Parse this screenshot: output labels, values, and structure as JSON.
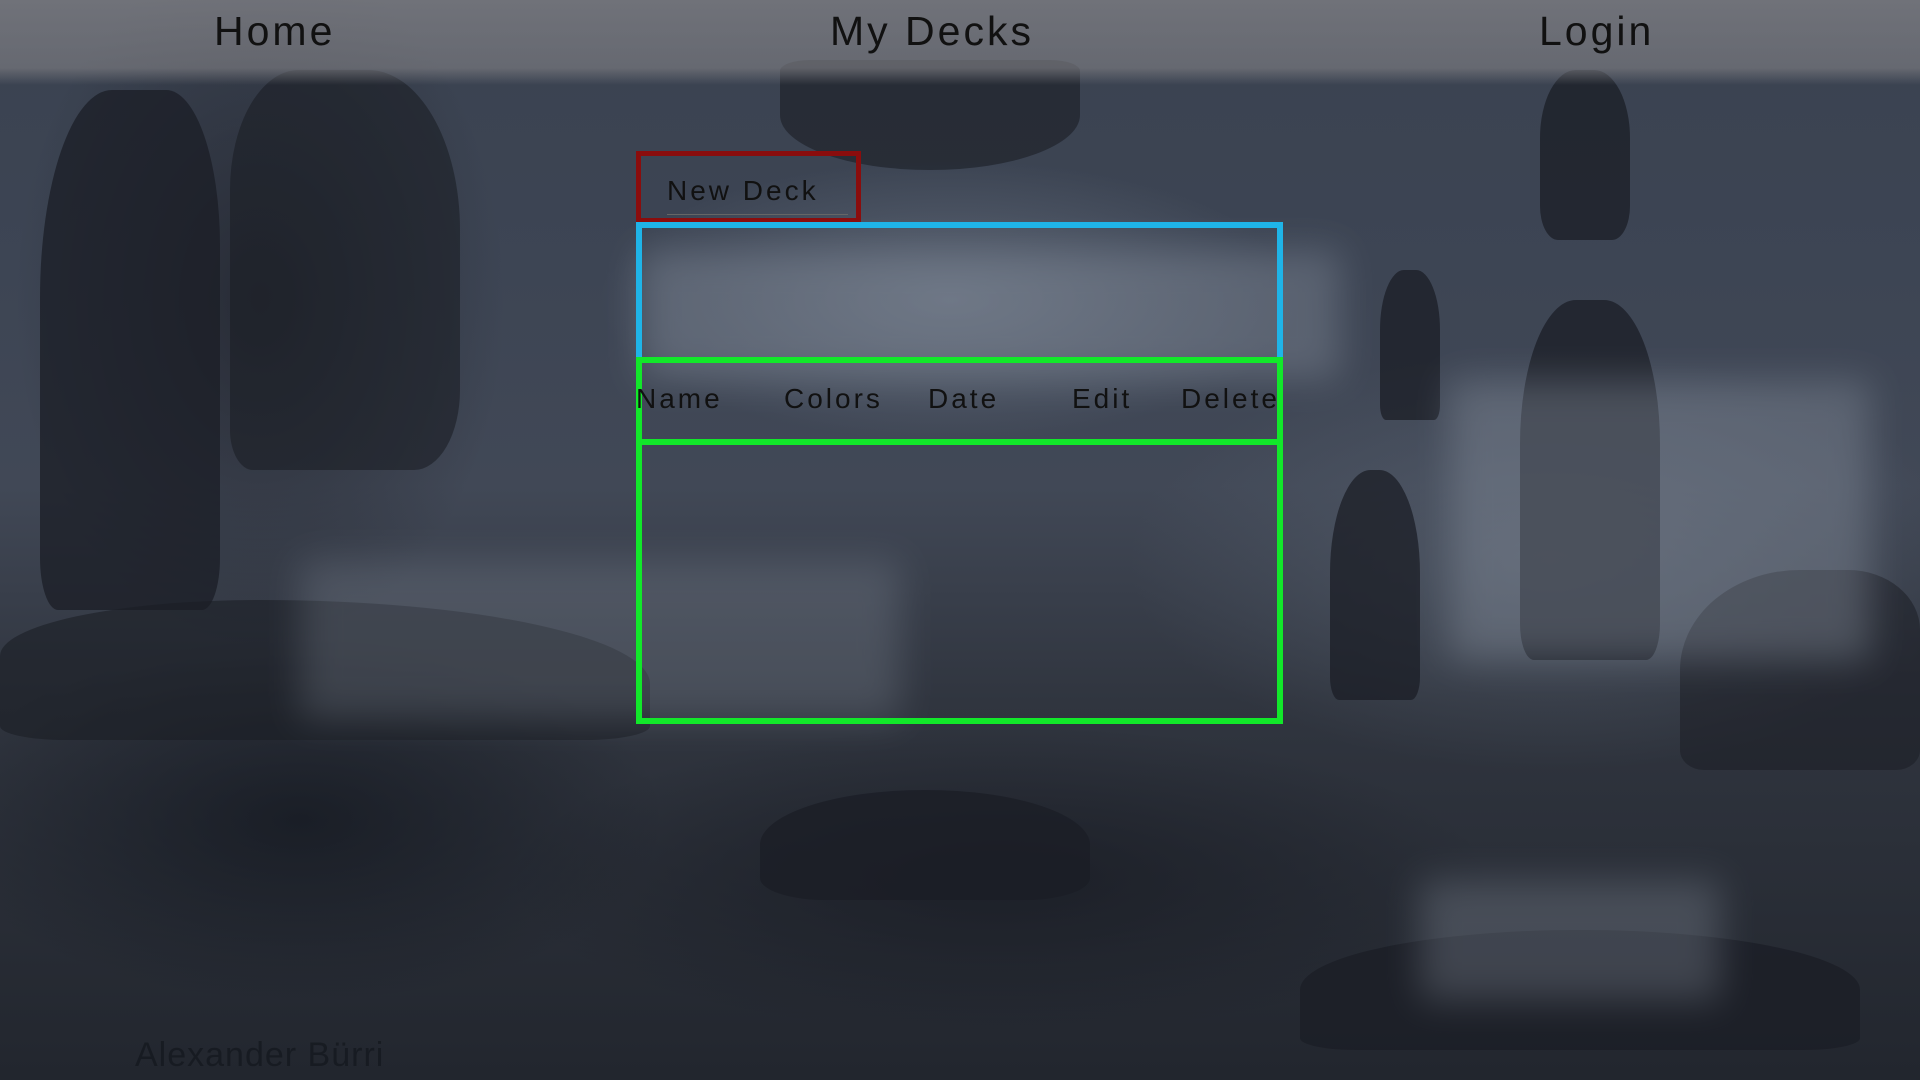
{
  "nav": {
    "home": "Home",
    "my_decks": "My Decks",
    "login": "Login"
  },
  "decks": {
    "new_deck_label": "New Deck",
    "columns": [
      "Name",
      "Colors",
      "Date",
      "Edit",
      "Delete"
    ],
    "rows": []
  },
  "background": {
    "signature": "Alexander Bürri"
  },
  "colors": {
    "new_deck_border": "#8a0d0d",
    "form_border": "#1fb4e8",
    "table_border": "#12e82a",
    "nav_bar": "#828287"
  }
}
